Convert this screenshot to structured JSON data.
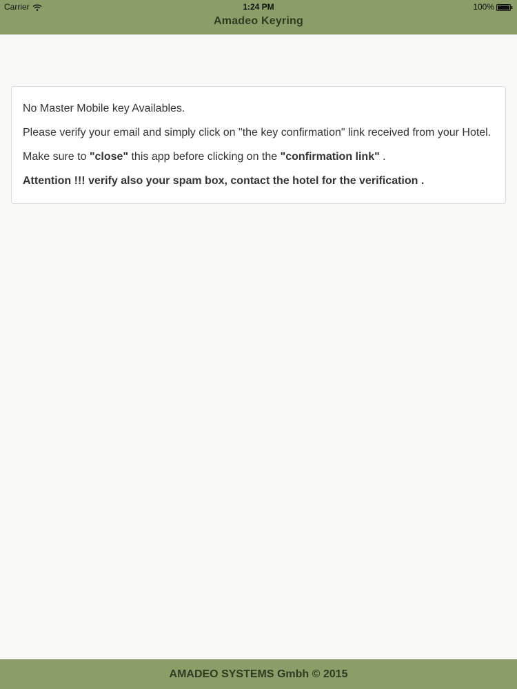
{
  "status_bar": {
    "carrier": "Carrier",
    "time": "1:24 PM",
    "battery": "100%",
    "wifi_icon": "wifi-icon",
    "battery_icon": "battery-icon"
  },
  "nav": {
    "title": "Amadeo Keyring"
  },
  "message": {
    "line1": "No Master Mobile key Availables.",
    "line2": "Please verify your email and simply click on \"the key confirmation\" link received from your Hotel.",
    "line3_prefix": "Make sure to ",
    "line3_close": "\"close\"",
    "line3_middle": " this app before clicking on the ",
    "line3_link": "\"confirmation link\"",
    "line3_suffix": " .",
    "line4": "Attention !!! verify also your spam box, contact the hotel for the verification ."
  },
  "footer": {
    "text": "AMADEO SYSTEMS Gmbh © 2015"
  },
  "colors": {
    "bar": "#8b9e68",
    "bar_text": "#2e3a22",
    "background": "#f8f8f7",
    "card_border": "#dcdcdc"
  }
}
